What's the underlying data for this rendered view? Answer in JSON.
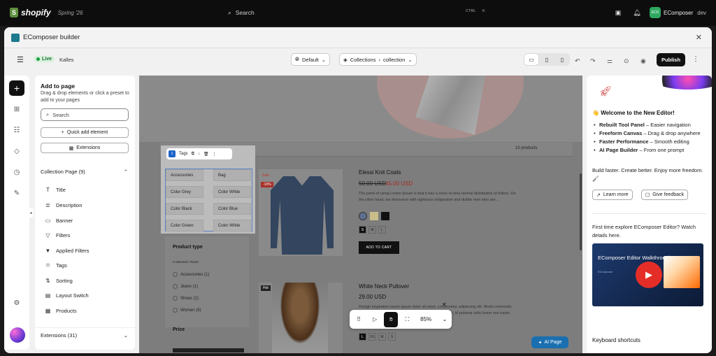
{
  "topbar": {
    "brand": "shopify",
    "edition": "Spring '26",
    "search_placeholder": "Search",
    "shortcut_ctrl": "CTRL",
    "shortcut_k": "K",
    "user_initials": "ECD",
    "user_name": "EComposer",
    "user_tag": "dev"
  },
  "modal": {
    "title": "EComposer builder",
    "status": "Live",
    "page_name": "Kalles",
    "theme_select": "Default",
    "template_type": "Collections",
    "template_name": "collection",
    "publish_label": "Publish"
  },
  "add_panel": {
    "title": "Add to page",
    "description": "Drag & drop elements or click a preset to add to your pages",
    "search_placeholder": "Search",
    "quick_add": "Quick add element",
    "extensions_btn": "Extensions",
    "section_title": "Collection Page (9)",
    "items": [
      "Title",
      "Description",
      "Banner",
      "Filters",
      "Applied Filters",
      "Tags",
      "Sorting",
      "Layout Switch",
      "Products"
    ],
    "footer": "Extensions (31)"
  },
  "canvas": {
    "product_count": "10 products",
    "tags_toolbar_label": "Tags",
    "tags_toolbar_badge": "1",
    "tags": [
      "Accessories",
      "Bag",
      "Color Grey",
      "Color White",
      "Color Black",
      "Color Blue",
      "Color Green",
      "Color White"
    ],
    "filter_title": "Product type",
    "filter_selected": "0 Selected",
    "filter_reset": "Reset",
    "filter_options": [
      "Accessories (1)",
      "Jeans (1)",
      "Shoes (2)",
      "Women (5)"
    ],
    "price_title": "Price",
    "product1": {
      "sale": "Sale",
      "discount": "-10%",
      "name": "Elessi Knit Coats",
      "old_price": "50.00 USD",
      "new_price": "45.00 USD",
      "desc": "The point of using Lorem Ipsum is that it has a more-or-less normal distribution of letters. On the other hand, we denounce with righteous indignation and dislike men who are...",
      "sizes": [
        "S",
        "M",
        "L"
      ],
      "cta": "ADD TO CART"
    },
    "product2": {
      "badge": "Hot",
      "name": "White Neck Pullover",
      "price": "29.00 USD",
      "desc": "Design inspiration lorem ipsum dolor sit amet, consectetur adipiscing elit. Morbi commodo, ipsum sed pharetra gravida, orci magna rhoncus neque, id pulvinar odio lorem non turpis.",
      "sizes": [
        "L",
        "XS",
        "M",
        "S"
      ]
    },
    "zoom": "85%",
    "ai_page": "AI Page"
  },
  "right_panel": {
    "heading": "Welcome to the New Editor!",
    "features": [
      {
        "bold": "Rebuilt Tool Panel",
        "text": " – Easier navigation"
      },
      {
        "bold": "Freeform Canvas",
        "text": " – Drag & drop anywhere"
      },
      {
        "bold": "Faster Performance",
        "text": " – Smooth editing"
      },
      {
        "bold": "AI Page Builder",
        "text": " – From one prompt"
      }
    ],
    "tagline": "Build faster. Create better. Enjoy more freedom. 🖌",
    "learn_more": "Learn more",
    "give_feedback": "Give feedback",
    "video_question": "First time explore EComposer Editor? Watch details here.",
    "video_title": "EComposer Editor Walkthrough",
    "video_brand": "EComposer",
    "keyboard_shortcuts": "Keyboard shortcuts"
  },
  "colors": {
    "accent": "#1a6fb0",
    "live_green": "#1a9e44",
    "publish_bg": "#111111"
  }
}
